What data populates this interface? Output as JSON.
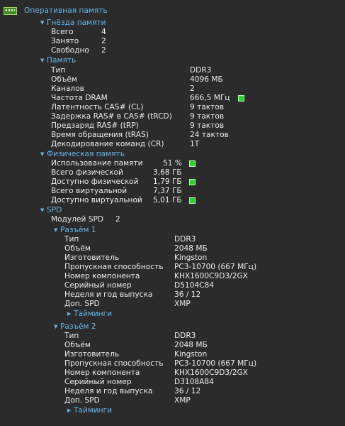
{
  "root": {
    "label": "Оперативная память",
    "icon": "ram-module-icon"
  },
  "slots": {
    "header": "Гнёзда памяти",
    "rows": [
      {
        "label": "Всего",
        "value": "4"
      },
      {
        "label": "Занято",
        "value": "2"
      },
      {
        "label": "Свободно",
        "value": "2"
      }
    ]
  },
  "memory": {
    "header": "Память",
    "rows": [
      {
        "label": "Тип",
        "value": "DDR3"
      },
      {
        "label": "Объём",
        "value": "4096 МБ"
      },
      {
        "label": "Каналов",
        "value": "2"
      },
      {
        "label": "Частота DRAM",
        "value": "666,5 МГц"
      },
      {
        "label": "Латентность CAS# (CL)",
        "value": "9 тактов"
      },
      {
        "label": "Задержка RAS# в CAS# (tRCD)",
        "value": "9 тактов"
      },
      {
        "label": "Предзаряд RAS# (tRP)",
        "value": "9 тактов"
      },
      {
        "label": "Время обращения (tRAS)",
        "value": "24 тактов"
      },
      {
        "label": "Декодирование команд (CR)",
        "value": "1T"
      }
    ]
  },
  "physical": {
    "header": "Физическая память",
    "rows": [
      {
        "label": "Использование памяти",
        "value": "51 %"
      },
      {
        "label": "Всего физической",
        "value": "3,68 ГБ"
      },
      {
        "label": "Доступно физической",
        "value": "1,79 ГБ"
      },
      {
        "label": "Всего виртуальной",
        "value": "7,37 ГБ"
      },
      {
        "label": "Доступно виртуальной",
        "value": "5,01 ГБ"
      }
    ]
  },
  "spd": {
    "header": "SPD",
    "modules_label": "Модулей SPD",
    "modules_value": "2",
    "slot1": {
      "header": "Разъём 1",
      "rows": [
        {
          "label": "Тип",
          "value": "DDR3"
        },
        {
          "label": "Объём",
          "value": "2048 МБ"
        },
        {
          "label": "Изготовитель",
          "value": "Kingston"
        },
        {
          "label": "Пропускная способность",
          "value": "PC3-10700 (667 МГц)"
        },
        {
          "label": "Номер компонента",
          "value": "KHX1600C9D3/2GX"
        },
        {
          "label": "Серийный номер",
          "value": "D5104C84"
        },
        {
          "label": "Неделя и год выпуска",
          "value": "36 / 12"
        },
        {
          "label": "Доп. SPD",
          "value": "XMP"
        }
      ],
      "timings": "Тайминги"
    },
    "slot2": {
      "header": "Разъём 2",
      "rows": [
        {
          "label": "Тип",
          "value": "DDR3"
        },
        {
          "label": "Объём",
          "value": "2048 МБ"
        },
        {
          "label": "Изготовитель",
          "value": "Kingston"
        },
        {
          "label": "Пропускная способность",
          "value": "PC3-10700 (667 МГц)"
        },
        {
          "label": "Номер компонента",
          "value": "KHX1600C9D3/2GX"
        },
        {
          "label": "Серийный номер",
          "value": "D3108A84"
        },
        {
          "label": "Неделя и год выпуска",
          "value": "36 / 12"
        },
        {
          "label": "Доп. SPD",
          "value": "XMP"
        }
      ],
      "timings": "Тайминги"
    }
  },
  "colors": {
    "background": "#2b2b2b",
    "header": "#67b6e6",
    "indicator": "#2fd22f"
  }
}
